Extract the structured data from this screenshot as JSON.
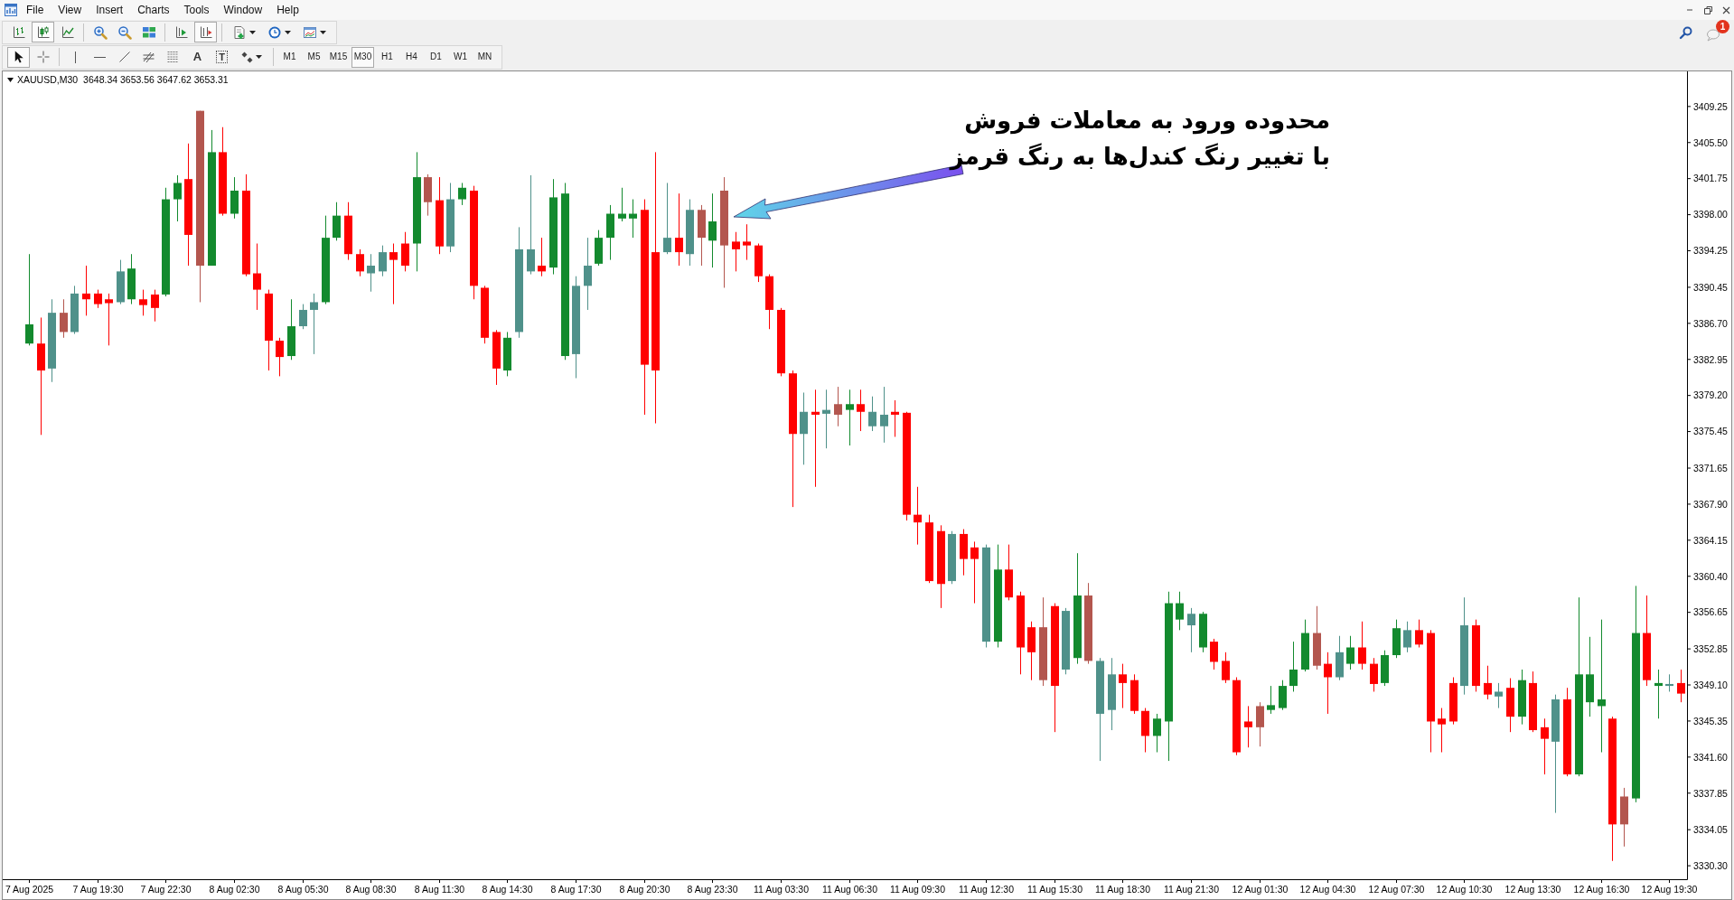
{
  "menu": [
    "File",
    "View",
    "Insert",
    "Charts",
    "Tools",
    "Window",
    "Help"
  ],
  "notifications": {
    "count": "1"
  },
  "standard_toolbar": [
    {
      "pressed": false
    },
    {
      "pressed": true
    },
    {
      "pressed": false
    },
    {
      "pressed": false
    },
    {
      "pressed": false
    },
    {
      "pressed": false
    },
    {
      "pressed": false
    },
    {
      "pressed": true
    },
    {
      "pressed": false
    },
    {
      "pressed": false
    },
    {
      "pressed": false
    }
  ],
  "drawing_toolbar": {
    "tools": [
      {
        "pressed": true
      },
      {
        "pressed": false
      },
      {
        "pressed": false
      },
      {
        "pressed": false
      },
      {
        "pressed": false
      },
      {
        "pressed": false
      },
      {
        "pressed": false
      },
      {
        "label": "A",
        "pressed": false
      },
      {
        "label": "T",
        "pressed": false
      },
      {
        "pressed": false
      }
    ],
    "timeframes": [
      {
        "label": "M1",
        "selected": false
      },
      {
        "label": "M5",
        "selected": false
      },
      {
        "label": "M15",
        "selected": false
      },
      {
        "label": "M30",
        "selected": true
      },
      {
        "label": "H1",
        "selected": false
      },
      {
        "label": "H4",
        "selected": false
      },
      {
        "label": "D1",
        "selected": false
      },
      {
        "label": "W1",
        "selected": false
      },
      {
        "label": "MN",
        "selected": false
      }
    ]
  },
  "chart": {
    "symbol": "XAUUSD,M30",
    "quotes": "3648.34 3653.56 3647.62 3653.31",
    "chart_data": [
      {
        "type": "candlestick",
        "categories": [
          "7 Aug 2025",
          null,
          null,
          null,
          null,
          null,
          "7 Aug 19:30",
          null,
          null,
          null,
          null,
          null,
          "7 Aug 22:30",
          null,
          null,
          null,
          null,
          null,
          "8 Aug 02:30",
          null,
          null,
          null,
          null,
          null,
          "8 Aug 05:30",
          null,
          null,
          null,
          null,
          null,
          "8 Aug 08:30",
          null,
          null,
          null,
          null,
          null,
          "8 Aug 11:30",
          null,
          null,
          null,
          null,
          null,
          "8 Aug 14:30",
          null,
          null,
          null,
          null,
          null,
          "8 Aug 17:30",
          null,
          null,
          null,
          null,
          null,
          "8 Aug 20:30",
          null,
          null,
          null,
          null,
          null,
          "8 Aug 23:30",
          null,
          null,
          null,
          null,
          null,
          "11 Aug 03:30",
          null,
          null,
          null,
          null,
          null,
          "11 Aug 06:30",
          null,
          null,
          null,
          null,
          null,
          "11 Aug 09:30",
          null,
          null,
          null,
          null,
          null,
          "11 Aug 12:30",
          null,
          null,
          null,
          null,
          null,
          "11 Aug 15:30",
          null,
          null,
          null,
          null,
          null,
          "11 Aug 18:30",
          null,
          null,
          null,
          null,
          null,
          "11 Aug 21:30",
          null,
          null,
          null,
          null,
          null,
          "12 Aug 01:30",
          null,
          null,
          null,
          null,
          null,
          "12 Aug 04:30",
          null,
          null,
          null,
          null,
          null,
          "12 Aug 07:30",
          null,
          null,
          null,
          null,
          null,
          "12 Aug 10:30",
          null,
          null,
          null,
          null,
          null,
          "12 Aug 13:30",
          null,
          null,
          null,
          null,
          null,
          "12 Aug 16:30",
          null,
          null,
          null,
          null,
          null,
          "12 Aug 19:30",
          null
        ],
        "ohlc": [
          [
            3384.6,
            3393.9,
            3384.4,
            3386.6
          ],
          [
            3384.6,
            3387.3,
            3375.1,
            3381.8
          ],
          [
            3382.0,
            3389.2,
            3380.6,
            3387.8
          ],
          [
            3387.8,
            3389.2,
            3385.2,
            3385.8
          ],
          [
            3385.8,
            3390.6,
            3385.6,
            3389.8
          ],
          [
            3389.8,
            3392.7,
            3387.5,
            3389.2
          ],
          [
            3389.8,
            3390.2,
            3388.3,
            3388.7
          ],
          [
            3389.2,
            3389.8,
            3384.4,
            3388.8
          ],
          [
            3388.9,
            3393.3,
            3388.7,
            3392.1
          ],
          [
            3389.2,
            3393.9,
            3388.7,
            3392.4
          ],
          [
            3389.2,
            3390.2,
            3387.5,
            3388.6
          ],
          [
            3389.7,
            3390.2,
            3386.9,
            3388.3
          ],
          [
            3389.7,
            3400.8,
            3389.5,
            3399.6
          ],
          [
            3399.6,
            3402.1,
            3397.3,
            3401.3
          ],
          [
            3401.7,
            3405.4,
            3392.7,
            3395.9
          ],
          [
            3408.8,
            3408.8,
            3388.9,
            3392.7
          ],
          [
            3392.7,
            3406.8,
            3392.7,
            3404.5
          ],
          [
            3404.5,
            3407.1,
            3397.9,
            3398.1
          ],
          [
            3398.1,
            3401.9,
            3397.6,
            3400.5
          ],
          [
            3400.5,
            3402.2,
            3391.6,
            3391.8
          ],
          [
            3391.9,
            3395.0,
            3388.1,
            3390.2
          ],
          [
            3389.8,
            3390.2,
            3381.8,
            3384.9
          ],
          [
            3384.9,
            3385.2,
            3381.2,
            3383.2
          ],
          [
            3383.3,
            3389.2,
            3382.9,
            3386.4
          ],
          [
            3386.4,
            3388.7,
            3386.1,
            3388.1
          ],
          [
            3388.1,
            3389.8,
            3383.5,
            3388.9
          ],
          [
            3388.9,
            3397.9,
            3388.7,
            3395.6
          ],
          [
            3395.6,
            3399.3,
            3395.3,
            3397.9
          ],
          [
            3397.9,
            3399.3,
            3393.3,
            3393.9
          ],
          [
            3393.9,
            3394.4,
            3391.6,
            3392.1
          ],
          [
            3391.9,
            3393.9,
            3390.0,
            3392.7
          ],
          [
            3392.1,
            3394.8,
            3391.6,
            3394.1
          ],
          [
            3394.1,
            3395.0,
            3388.7,
            3393.3
          ],
          [
            3395.0,
            3396.2,
            3392.1,
            3392.7
          ],
          [
            3395.0,
            3404.5,
            3392.1,
            3401.9
          ],
          [
            3401.9,
            3402.2,
            3397.9,
            3399.3
          ],
          [
            3399.5,
            3401.9,
            3393.9,
            3394.7
          ],
          [
            3394.7,
            3401.3,
            3394.1,
            3399.6
          ],
          [
            3399.6,
            3401.3,
            3399.0,
            3400.8
          ],
          [
            3400.5,
            3401.0,
            3389.2,
            3390.6
          ],
          [
            3390.4,
            3390.6,
            3384.6,
            3385.2
          ],
          [
            3385.8,
            3386.0,
            3380.3,
            3382.0
          ],
          [
            3381.8,
            3385.8,
            3381.2,
            3385.2
          ],
          [
            3385.8,
            3396.7,
            3385.2,
            3394.4
          ],
          [
            3392.1,
            3402.1,
            3391.8,
            3394.4
          ],
          [
            3392.7,
            3395.6,
            3391.6,
            3392.1
          ],
          [
            3392.5,
            3401.7,
            3391.8,
            3399.8
          ],
          [
            3383.3,
            3401.3,
            3382.9,
            3400.2
          ],
          [
            3383.5,
            3391.6,
            3381.0,
            3390.6
          ],
          [
            3390.6,
            3395.6,
            3388.1,
            3392.7
          ],
          [
            3392.9,
            3396.4,
            3392.7,
            3395.6
          ],
          [
            3395.6,
            3399.0,
            3393.3,
            3398.1
          ],
          [
            3397.6,
            3400.8,
            3397.3,
            3398.1
          ],
          [
            3397.6,
            3399.6,
            3395.6,
            3398.1
          ],
          [
            3398.5,
            3399.6,
            3377.2,
            3382.4
          ],
          [
            3394.1,
            3404.5,
            3376.3,
            3381.8
          ],
          [
            3394.1,
            3401.3,
            3393.9,
            3395.6
          ],
          [
            3395.6,
            3400.2,
            3392.7,
            3394.1
          ],
          [
            3393.9,
            3399.6,
            3392.7,
            3398.5
          ],
          [
            3398.5,
            3399.0,
            3392.7,
            3395.6
          ],
          [
            3395.3,
            3400.2,
            3392.5,
            3397.3
          ],
          [
            3400.5,
            3401.9,
            3390.4,
            3394.8
          ],
          [
            3395.2,
            3396.2,
            3392.1,
            3394.4
          ],
          [
            3395.2,
            3397.0,
            3393.3,
            3394.8
          ],
          [
            3394.8,
            3395.0,
            3391.0,
            3391.6
          ],
          [
            3391.6,
            3391.8,
            3386.1,
            3388.1
          ],
          [
            3388.1,
            3388.3,
            3381.2,
            3381.5
          ],
          [
            3381.5,
            3381.8,
            3367.6,
            3375.2
          ],
          [
            3375.2,
            3379.5,
            3372.0,
            3377.5
          ],
          [
            3377.5,
            3379.8,
            3369.7,
            3377.2
          ],
          [
            3377.3,
            3379.8,
            3373.7,
            3377.7
          ],
          [
            3378.3,
            3380.1,
            3376.0,
            3377.2
          ],
          [
            3377.7,
            3379.8,
            3374.0,
            3378.3
          ],
          [
            3378.3,
            3379.8,
            3375.5,
            3377.5
          ],
          [
            3376.0,
            3379.1,
            3375.5,
            3377.5
          ],
          [
            3376.0,
            3380.1,
            3374.3,
            3377.2
          ],
          [
            3377.5,
            3378.7,
            3374.9,
            3377.2
          ],
          [
            3377.4,
            3377.5,
            3366.2,
            3366.8
          ],
          [
            3366.8,
            3369.7,
            3363.7,
            3366.0
          ],
          [
            3366.0,
            3366.8,
            3359.7,
            3359.9
          ],
          [
            3365.1,
            3365.7,
            3357.1,
            3359.6
          ],
          [
            3359.9,
            3365.1,
            3359.6,
            3364.8
          ],
          [
            3364.8,
            3365.3,
            3360.5,
            3362.2
          ],
          [
            3363.4,
            3364.0,
            3357.6,
            3362.2
          ],
          [
            3353.6,
            3363.7,
            3353.0,
            3363.4
          ],
          [
            3353.6,
            3363.7,
            3353.0,
            3361.1
          ],
          [
            3361.1,
            3363.7,
            3357.9,
            3358.2
          ],
          [
            3358.4,
            3358.8,
            3350.2,
            3353.0
          ],
          [
            3355.1,
            3355.7,
            3349.6,
            3352.5
          ],
          [
            3355.1,
            3358.2,
            3349.0,
            3349.6
          ],
          [
            3357.3,
            3357.6,
            3344.2,
            3349.0
          ],
          [
            3350.7,
            3357.1,
            3350.2,
            3356.8
          ],
          [
            3351.9,
            3362.8,
            3351.3,
            3358.4
          ],
          [
            3358.4,
            3359.7,
            3351.3,
            3351.6
          ],
          [
            3346.1,
            3351.9,
            3341.2,
            3351.6
          ],
          [
            3346.5,
            3351.9,
            3344.4,
            3350.2
          ],
          [
            3350.2,
            3351.3,
            3346.7,
            3349.3
          ],
          [
            3349.6,
            3350.2,
            3346.1,
            3346.4
          ],
          [
            3346.4,
            3346.7,
            3342.1,
            3343.8
          ],
          [
            3343.8,
            3346.1,
            3342.1,
            3345.6
          ],
          [
            3345.3,
            3358.8,
            3341.2,
            3357.6
          ],
          [
            3355.9,
            3358.8,
            3354.8,
            3357.6
          ],
          [
            3355.3,
            3357.1,
            3352.5,
            3356.5
          ],
          [
            3353.0,
            3356.7,
            3352.5,
            3356.5
          ],
          [
            3353.6,
            3353.9,
            3350.7,
            3351.5
          ],
          [
            3351.6,
            3352.5,
            3349.3,
            3349.6
          ],
          [
            3349.6,
            3349.9,
            3341.8,
            3342.1
          ],
          [
            3345.3,
            3346.9,
            3342.6,
            3344.7
          ],
          [
            3346.9,
            3347.3,
            3342.7,
            3344.7
          ],
          [
            3346.5,
            3349.0,
            3346.1,
            3347.0
          ],
          [
            3346.7,
            3349.6,
            3346.5,
            3349.0
          ],
          [
            3349.0,
            3353.6,
            3348.4,
            3350.7
          ],
          [
            3350.7,
            3355.9,
            3350.5,
            3354.5
          ],
          [
            3354.5,
            3357.3,
            3350.7,
            3351.1
          ],
          [
            3351.3,
            3352.5,
            3346.1,
            3349.9
          ],
          [
            3349.9,
            3354.2,
            3349.6,
            3352.5
          ],
          [
            3351.3,
            3354.2,
            3350.7,
            3353.0
          ],
          [
            3353.0,
            3355.7,
            3350.7,
            3351.3
          ],
          [
            3351.3,
            3351.9,
            3348.4,
            3349.2
          ],
          [
            3349.3,
            3352.7,
            3349.0,
            3352.2
          ],
          [
            3352.2,
            3355.9,
            3351.9,
            3355.0
          ],
          [
            3353.0,
            3355.7,
            3352.5,
            3354.8
          ],
          [
            3354.8,
            3355.9,
            3353.0,
            3353.3
          ],
          [
            3354.5,
            3354.8,
            3342.1,
            3345.3
          ],
          [
            3345.6,
            3346.7,
            3342.1,
            3345.0
          ],
          [
            3349.3,
            3349.9,
            3345.0,
            3345.3
          ],
          [
            3349.0,
            3358.2,
            3348.1,
            3355.3
          ],
          [
            3355.3,
            3355.9,
            3348.4,
            3349.0
          ],
          [
            3349.3,
            3351.1,
            3347.6,
            3348.1
          ],
          [
            3347.9,
            3349.3,
            3346.7,
            3348.4
          ],
          [
            3348.8,
            3349.8,
            3344.2,
            3345.8
          ],
          [
            3345.8,
            3350.7,
            3345.0,
            3349.6
          ],
          [
            3349.3,
            3350.5,
            3344.2,
            3344.4
          ],
          [
            3344.7,
            3345.6,
            3339.8,
            3343.5
          ],
          [
            3343.2,
            3348.1,
            3335.8,
            3347.6
          ],
          [
            3347.6,
            3348.8,
            3339.6,
            3339.8
          ],
          [
            3339.8,
            3358.2,
            3339.6,
            3350.2
          ],
          [
            3347.3,
            3354.1,
            3345.8,
            3350.2
          ],
          [
            3346.9,
            3355.9,
            3342.1,
            3347.6
          ],
          [
            3345.6,
            3345.8,
            3330.8,
            3334.6
          ],
          [
            3337.5,
            3338.4,
            3332.3,
            3334.6
          ],
          [
            3337.3,
            3359.4,
            3336.9,
            3354.5
          ],
          [
            3354.5,
            3358.4,
            3349.0,
            3349.6
          ],
          [
            3349.0,
            3350.7,
            3345.6,
            3349.3
          ],
          [
            3349.0,
            3350.2,
            3348.4,
            3349.2
          ],
          [
            3349.3,
            3350.7,
            3347.3,
            3348.2
          ]
        ],
        "colors": [
          "#138a2e",
          "#ff0000",
          "#4f918a",
          "#b3564e",
          "#4f918a",
          "#ff0000",
          "#ff0000",
          "#ff0000",
          "#4f918a",
          "#138a2e",
          "#ff0000",
          "#ff0000",
          "#138a2e",
          "#138a2e",
          "#ff0000",
          "#b3564e",
          "#138a2e",
          "#ff0000",
          "#138a2e",
          "#ff0000",
          "#ff0000",
          "#ff0000",
          "#ff0000",
          "#138a2e",
          "#4f918a",
          "#4f918a",
          "#138a2e",
          "#138a2e",
          "#ff0000",
          "#ff0000",
          "#4f918a",
          "#4f918a",
          "#ff0000",
          "#ff0000",
          "#138a2e",
          "#b3564e",
          "#ff0000",
          "#4f918a",
          "#138a2e",
          "#ff0000",
          "#ff0000",
          "#ff0000",
          "#138a2e",
          "#4f918a",
          "#4f918a",
          "#ff0000",
          "#138a2e",
          "#138a2e",
          "#4f918a",
          "#4f918a",
          "#138a2e",
          "#138a2e",
          "#138a2e",
          "#138a2e",
          "#ff0000",
          "#ff0000",
          "#4f918a",
          "#ff0000",
          "#4f918a",
          "#b3564e",
          "#138a2e",
          "#b3564e",
          "#ff0000",
          "#ff0000",
          "#ff0000",
          "#ff0000",
          "#ff0000",
          "#ff0000",
          "#4f918a",
          "#ff0000",
          "#4f918a",
          "#b3564e",
          "#138a2e",
          "#ff0000",
          "#4f918a",
          "#4f918a",
          "#ff0000",
          "#ff0000",
          "#ff0000",
          "#ff0000",
          "#ff0000",
          "#4f918a",
          "#ff0000",
          "#ff0000",
          "#4f918a",
          "#138a2e",
          "#ff0000",
          "#ff0000",
          "#ff0000",
          "#b3564e",
          "#ff0000",
          "#4f918a",
          "#138a2e",
          "#b3564e",
          "#4f918a",
          "#4f918a",
          "#ff0000",
          "#ff0000",
          "#ff0000",
          "#138a2e",
          "#138a2e",
          "#138a2e",
          "#4f918a",
          "#138a2e",
          "#ff0000",
          "#ff0000",
          "#ff0000",
          "#ff0000",
          "#b3564e",
          "#138a2e",
          "#138a2e",
          "#138a2e",
          "#138a2e",
          "#b3564e",
          "#ff0000",
          "#4f918a",
          "#138a2e",
          "#ff0000",
          "#ff0000",
          "#138a2e",
          "#138a2e",
          "#4f918a",
          "#ff0000",
          "#ff0000",
          "#ff0000",
          "#ff0000",
          "#4f918a",
          "#ff0000",
          "#ff0000",
          "#4f918a",
          "#ff0000",
          "#138a2e",
          "#ff0000",
          "#ff0000",
          "#4f918a",
          "#ff0000",
          "#138a2e",
          "#138a2e",
          "#138a2e",
          "#ff0000",
          "#b3564e",
          "#138a2e",
          "#ff0000",
          "#138a2e",
          "#4f918a",
          "#ff0000"
        ],
        "ylim": [
          3328.9,
          3412.9
        ],
        "yticks": [
          {
            "value": 3409.25,
            "label": "3409.25"
          },
          {
            "value": 3405.5,
            "label": "3405.50"
          },
          {
            "value": 3401.75,
            "label": "3401.75"
          },
          {
            "value": 3398.0,
            "label": "3398.00"
          },
          {
            "value": 3394.25,
            "label": "3394.25"
          },
          {
            "value": 3390.45,
            "label": "3390.45"
          },
          {
            "value": 3386.7,
            "label": "3386.70"
          },
          {
            "value": 3382.95,
            "label": "3382.95"
          },
          {
            "value": 3379.2,
            "label": "3379.20"
          },
          {
            "value": 3375.45,
            "label": "3375.45"
          },
          {
            "value": 3371.65,
            "label": "3371.65"
          },
          {
            "value": 3367.9,
            "label": "3367.90"
          },
          {
            "value": 3364.15,
            "label": "3364.15"
          },
          {
            "value": 3360.4,
            "label": "3360.40"
          },
          {
            "value": 3356.65,
            "label": "3356.65"
          },
          {
            "value": 3352.85,
            "label": "3352.85"
          },
          {
            "value": 3349.1,
            "label": "3349.10"
          },
          {
            "value": 3345.35,
            "label": "3345.35"
          },
          {
            "value": 3341.6,
            "label": "3341.60"
          },
          {
            "value": 3337.85,
            "label": "3337.85"
          },
          {
            "value": 3334.05,
            "label": "3334.05"
          },
          {
            "value": 3330.3,
            "label": "3330.30"
          }
        ],
        "annotations": [
          "محدوده ورود به معاملات فروش",
          "با تغییر رنگ کندل‌ها به رنگ قرمز"
        ]
      }
    ]
  }
}
